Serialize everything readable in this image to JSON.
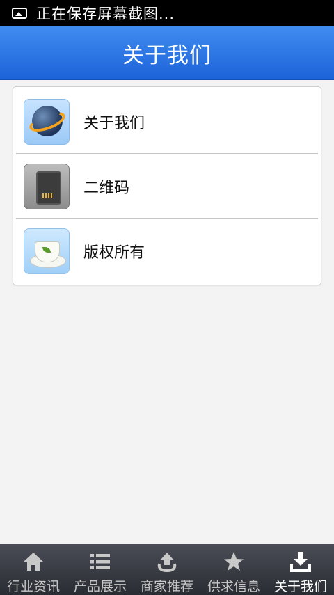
{
  "statusbar": {
    "notification_text": "正在保存屏幕截图..."
  },
  "titlebar": {
    "title": "关于我们"
  },
  "list": {
    "items": [
      {
        "label": "关于我们",
        "icon": "globe-icon"
      },
      {
        "label": "二维码",
        "icon": "sd-card-icon"
      },
      {
        "label": "版权所有",
        "icon": "teacup-icon"
      }
    ]
  },
  "tabbar": {
    "tabs": [
      {
        "label": "行业资讯",
        "icon": "home-icon"
      },
      {
        "label": "产品展示",
        "icon": "list-icon"
      },
      {
        "label": "商家推荐",
        "icon": "upload-icon"
      },
      {
        "label": "供求信息",
        "icon": "star-icon"
      },
      {
        "label": "关于我们",
        "icon": "download-icon",
        "active": true
      }
    ]
  },
  "colors": {
    "title_bar": "#2f78e8",
    "tab_bar": "#33363e",
    "background": "#f3f3f3"
  }
}
